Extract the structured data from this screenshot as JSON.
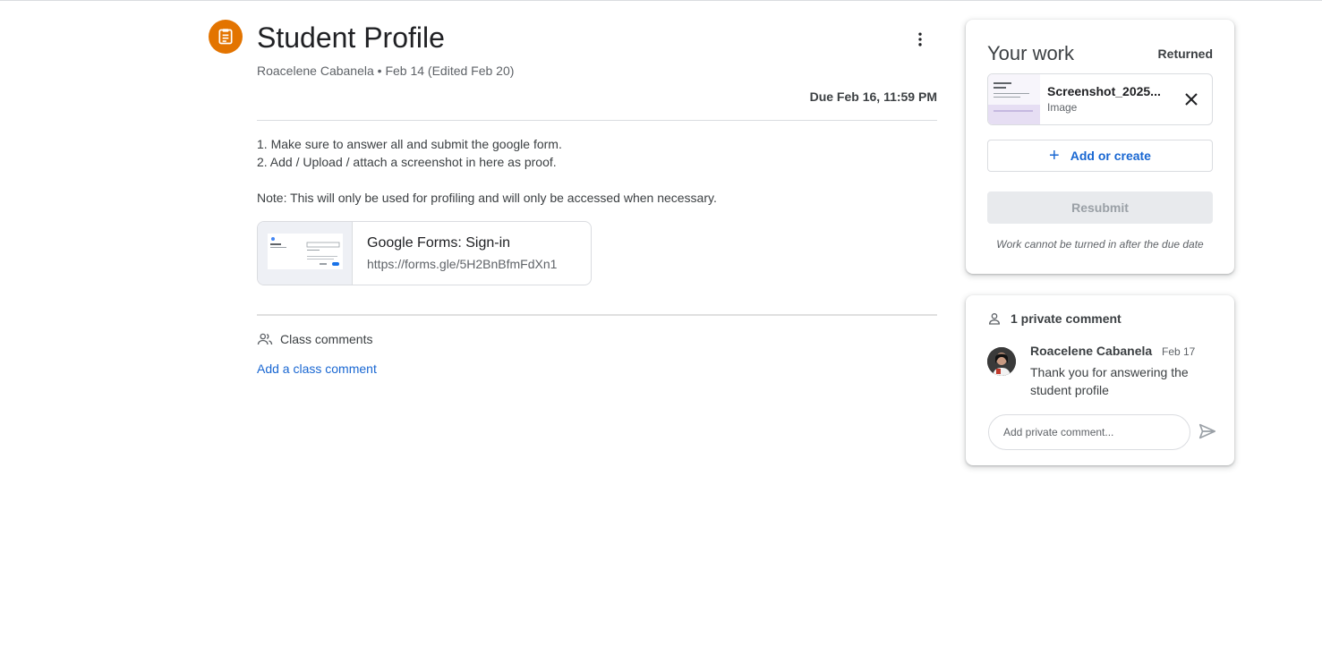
{
  "assignment": {
    "icon": "assignment-icon",
    "title": "Student Profile",
    "meta": "Roacelene Cabanela • Feb 14 (Edited Feb 20)",
    "due": "Due Feb 16, 11:59 PM",
    "more_icon": "more-vert-icon",
    "description": [
      "1. Make sure to answer all and submit the google form.",
      "2. Add / Upload / attach a screenshot in here as proof.",
      "",
      "Note: This will only be used for profiling and will only be accessed when necessary."
    ],
    "attachment": {
      "title": "Google Forms: Sign-in",
      "url": "https://forms.gle/5H2BnBfmFdXn1"
    },
    "class_comments": {
      "icon": "people-icon",
      "label": "Class comments",
      "add_link": "Add a class comment"
    }
  },
  "your_work": {
    "title": "Your work",
    "status": "Returned",
    "file": {
      "name": "Screenshot_2025...",
      "type": "Image",
      "close_icon": "close-icon"
    },
    "add_label": "Add or create",
    "resubmit_label": "Resubmit",
    "note": "Work cannot be turned in after the due date"
  },
  "private_comments": {
    "icon": "person-icon",
    "header": "1 private comment",
    "comments": [
      {
        "author": "Roacelene Cabanela",
        "date": "Feb 17",
        "text": "Thank you for answering the student profile"
      }
    ],
    "input_placeholder": "Add private comment...",
    "send_icon": "send-icon"
  },
  "colors": {
    "accent_orange": "#e37400",
    "link_blue": "#1967d2",
    "text_primary": "#3c4043",
    "text_secondary": "#5f6368",
    "divider": "#dadce0"
  }
}
